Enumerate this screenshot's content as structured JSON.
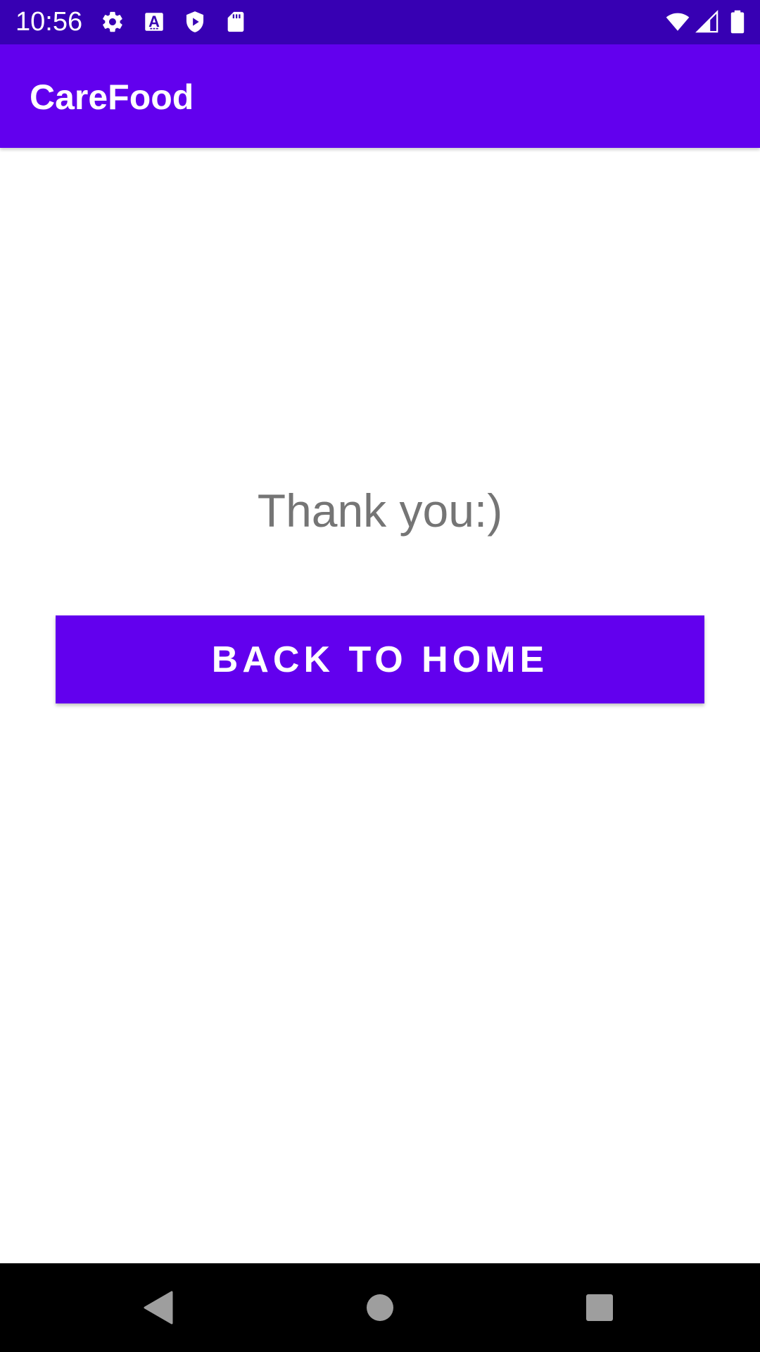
{
  "status_bar": {
    "time": "10:56",
    "icons_left": [
      "gear-icon",
      "font-a-icon",
      "play-protect-icon",
      "sd-card-icon"
    ],
    "icons_right": [
      "wifi-icon",
      "cell-signal-icon",
      "battery-icon"
    ],
    "background": "#3700B3"
  },
  "app_bar": {
    "title": "CareFood",
    "background": "#6200EE"
  },
  "main": {
    "message": "Thank you:)",
    "button_label": "BACK TO HOME",
    "button_color": "#6200EE",
    "message_color": "#757575"
  },
  "nav_bar": {
    "buttons": [
      "back-icon",
      "home-icon",
      "recents-icon"
    ]
  }
}
